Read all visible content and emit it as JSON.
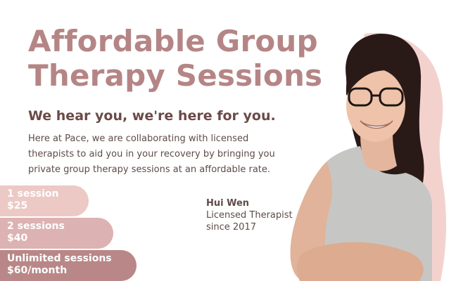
{
  "headline": {
    "line1": "Affordable Group",
    "line2": "Therapy Sessions"
  },
  "tagline": "We hear you, we're here for you.",
  "description": {
    "line1": "Here at Pace, we are collaborating with licensed",
    "line2": "therapists to aid you in your recovery by bringing you",
    "line3": "private group therapy sessions at an affordable rate."
  },
  "pricing": [
    {
      "sessions": "1 session",
      "price": "$25"
    },
    {
      "sessions": "2 sessions",
      "price": "$40"
    },
    {
      "sessions": "Unlimited sessions",
      "price": "$60/month"
    }
  ],
  "therapist": {
    "name": "Hui Wen",
    "role": "Licensed Therapist",
    "since": "since 2017"
  },
  "colors": {
    "headline": "#b58585",
    "tagline": "#6b4a47",
    "pill_1": "#ecc9c5",
    "pill_2": "#ddb2b2",
    "pill_3": "#b98787",
    "photo_backdrop": "#f3d2ce"
  }
}
